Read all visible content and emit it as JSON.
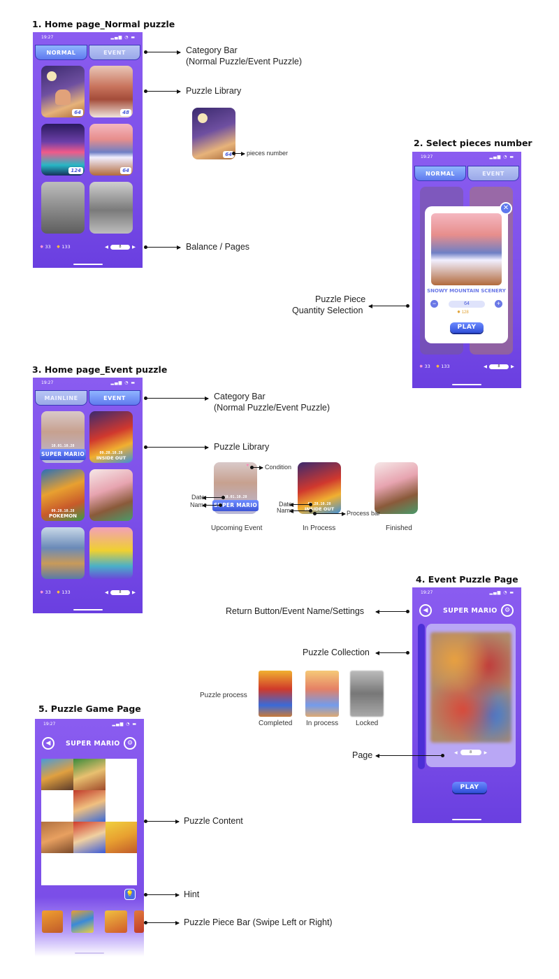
{
  "sections": {
    "s1": "1. Home page_Normal puzzle",
    "s2": "2. Select pieces number",
    "s3": "3. Home page_Event puzzle",
    "s4": "4. Event Puzzle Page",
    "s5": "5. Puzzle Game Page"
  },
  "annotations": {
    "s1_category_bar": "Category Bar",
    "s1_category_bar_sub": "(Normal Puzzle/Event Puzzle)",
    "s1_puzzle_library": "Puzzle Library",
    "s1_pieces_number": "pieces number",
    "s1_balance_pages": "Balance / Pages",
    "s2_quantity_1": "Puzzle Piece",
    "s2_quantity_2": "Quantity Selection",
    "s3_category_bar": "Category Bar",
    "s3_category_bar_sub": "(Normal Puzzle/Event Puzzle)",
    "s3_puzzle_library": "Puzzle Library",
    "s3_condition": "Condition",
    "s3_date": "Date",
    "s3_name": "Name",
    "s3_date2": "Date",
    "s3_name2": "Name",
    "s3_process_bar": "Process bar",
    "s3_upcoming": "Upcoming Event",
    "s3_in_process": "In Process",
    "s3_finished": "Finished",
    "s4_return": "Return Button/Event Name/Settings",
    "s4_collection": "Puzzle Collection",
    "s4_puzzle_process": "Puzzle process",
    "s4_completed": "Completed",
    "s4_in_process": "In process",
    "s4_locked": "Locked",
    "s4_page": "Page",
    "s5_content": "Puzzle Content",
    "s5_hint": "Hint",
    "s5_piece_bar": "Puzzle Piece Bar (Swipe Left or Right)"
  },
  "screen1": {
    "time": "19:27",
    "tab_normal": "NORMAL",
    "tab_event": "EVENT",
    "tiles": [
      {
        "badge": "64"
      },
      {
        "badge": "48"
      },
      {
        "badge": "124"
      },
      {
        "badge": "64"
      },
      {
        "badge": ""
      },
      {
        "badge": ""
      }
    ],
    "sample_badge": "64",
    "gems": "33",
    "coins": "133",
    "page": "8"
  },
  "screen2": {
    "time": "19:27",
    "tab_normal": "NORMAL",
    "tab_event": "EVENT",
    "puzzle_name": "SNOWY MOUNTAIN SCENERY",
    "quantity": "64",
    "cost": "128",
    "play": "PLAY",
    "gems": "33",
    "coins": "133",
    "page": "8"
  },
  "screen3": {
    "time": "19:27",
    "tab_mainline": "MAINLINE",
    "tab_event": "EVENT",
    "events": [
      {
        "date": "10.01.10.28",
        "name": "SUPER MARIO"
      },
      {
        "date": "09.28.10.28",
        "name": "INSIDE OUT"
      },
      {
        "date": "09.28.10.28",
        "name": "POKEMON"
      },
      {
        "date": "",
        "name": ""
      },
      {
        "date": "",
        "name": ""
      },
      {
        "date": "",
        "name": ""
      }
    ],
    "sample_upcoming": {
      "date": "10.01.10.28",
      "name": "SUPER MARIO"
    },
    "sample_inprocess": {
      "date": "09.28.10.28",
      "name": "INSIDE OUT"
    },
    "gems": "33",
    "coins": "133",
    "page": "8"
  },
  "screen4": {
    "time": "19:27",
    "title": "SUPER MARIO",
    "page": "8",
    "play": "PLAY"
  },
  "screen5": {
    "time": "19:27",
    "title": "SUPER MARIO"
  },
  "colors": {
    "phone_bg": "#7b4ee8",
    "tab_active": "#5f79ee",
    "play_button": "#2f4fd8"
  }
}
